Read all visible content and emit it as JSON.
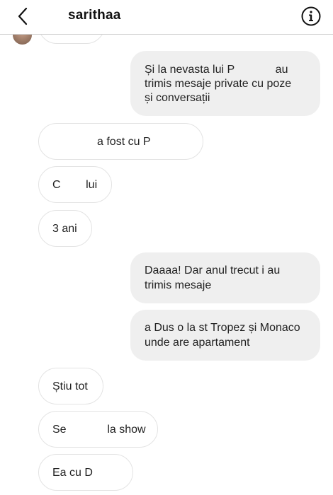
{
  "header": {
    "username": "sarithaa"
  },
  "messages": [
    {
      "dir": "in",
      "lines": [
        ""
      ]
    },
    {
      "dir": "out",
      "lines": [
        "Și la nevasta lui P             au",
        "trimis mesaje private cu poze",
        "și conversații"
      ]
    },
    {
      "dir": "in",
      "lines": [
        "a fost cu P"
      ]
    },
    {
      "dir": "in",
      "lines": [
        "C        lui"
      ]
    },
    {
      "dir": "in",
      "lines": [
        "3 ani"
      ]
    },
    {
      "dir": "out",
      "lines": [
        "Daaaa! Dar anul trecut i au",
        "trimis mesaje"
      ]
    },
    {
      "dir": "out",
      "lines": [
        "a Dus o la st Tropez și Monaco",
        "unde are apartament"
      ]
    },
    {
      "dir": "in",
      "lines": [
        "Știu tot"
      ]
    },
    {
      "dir": "in",
      "lines": [
        "Se             la show"
      ]
    },
    {
      "dir": "in",
      "lines": [
        "Ea cu D"
      ]
    }
  ]
}
